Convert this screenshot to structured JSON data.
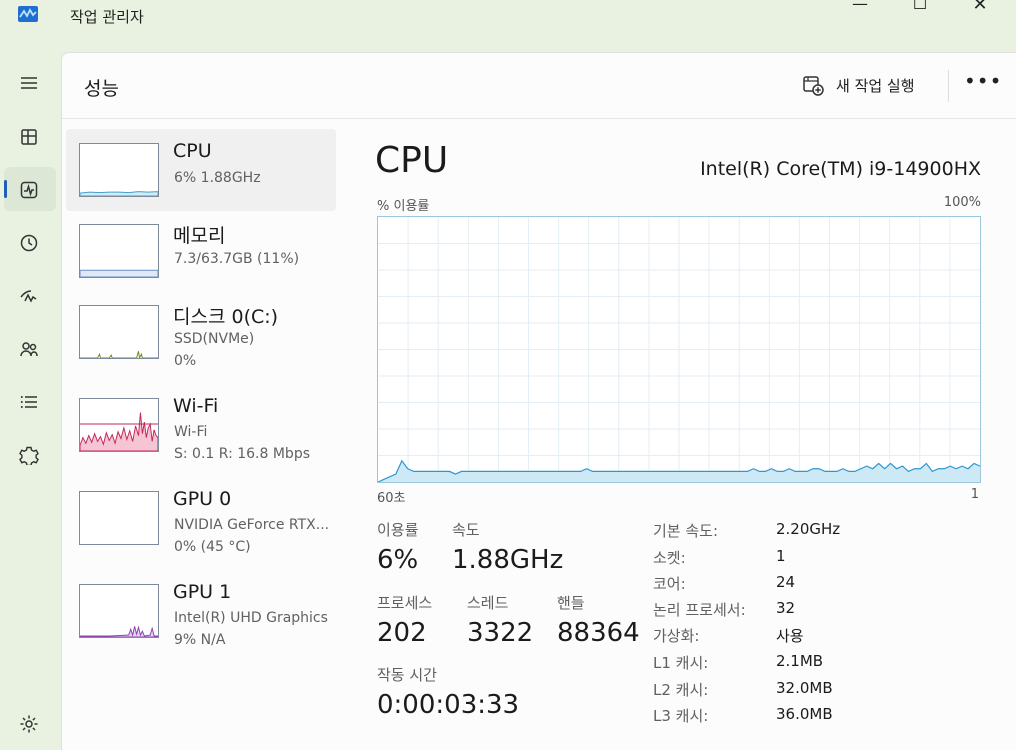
{
  "window": {
    "title": "작업 관리자",
    "minimize_glyph": "—",
    "maximize_glyph": "☐",
    "close_glyph": "✕"
  },
  "header": {
    "title": "성능",
    "new_task_label": "새 작업 실행",
    "more_glyph": "•••"
  },
  "nav": [
    "menu-icon",
    "processes-icon",
    "performance-icon",
    "app-history-icon",
    "startup-icon",
    "users-icon",
    "details-icon",
    "services-icon",
    "settings-icon"
  ],
  "devices": [
    {
      "name": "CPU",
      "lines": [
        "6% 1.88GHz"
      ],
      "color": "#117dbb"
    },
    {
      "name": "메모리",
      "lines": [
        "7.3/63.7GB (11%)"
      ],
      "color": "#8b6ec7"
    },
    {
      "name": "디스크 0(C:)",
      "lines": [
        "SSD(NVMe)",
        "0%"
      ],
      "color": "#4da60c"
    },
    {
      "name": "Wi-Fi",
      "lines": [
        "Wi-Fi",
        "S: 0.1  R: 16.8 Mbps"
      ],
      "color": "#a74f01"
    },
    {
      "name": "GPU 0",
      "lines": [
        "NVIDIA GeForce RTX...",
        "0% (45 °C)"
      ],
      "color": "#8e44ad"
    },
    {
      "name": "GPU 1",
      "lines": [
        "Intel(R) UHD Graphics",
        "9% N/A"
      ],
      "color": "#8e44ad"
    }
  ],
  "detail": {
    "title": "CPU",
    "model": "Intel(R) Core(TM) i9-14900HX",
    "graph_label": "% 이용률",
    "graph_max": "100%",
    "axis_left": "60초",
    "axis_right": "1",
    "utilization_series": [
      0,
      1,
      2,
      3,
      8,
      5,
      4,
      4,
      4,
      4,
      4,
      4,
      4,
      3,
      4,
      4,
      4,
      4,
      4,
      4,
      4,
      4,
      4,
      4,
      4,
      4,
      4,
      4,
      4,
      4,
      4,
      4,
      4,
      4,
      4,
      5,
      4,
      4,
      4,
      4,
      4,
      4,
      4,
      4,
      4,
      4,
      4,
      4,
      4,
      4,
      4,
      4,
      4,
      4,
      4,
      4,
      4,
      4,
      4,
      4,
      4,
      4,
      4,
      5,
      4,
      4,
      5,
      4,
      4,
      5,
      4,
      4,
      4,
      5,
      5,
      4,
      4,
      4,
      5,
      4,
      4,
      5,
      6,
      5,
      7,
      5,
      7,
      5,
      6,
      4,
      5,
      5,
      7,
      4,
      5,
      5,
      6,
      5,
      6,
      5,
      7,
      6
    ],
    "stats": {
      "util_label": "이용률",
      "util_value": "6%",
      "speed_label": "속도",
      "speed_value": "1.88GHz",
      "proc_label": "프로세스",
      "proc_value": "202",
      "thread_label": "스레드",
      "thread_value": "3322",
      "handle_label": "핸들",
      "handle_value": "88364",
      "uptime_label": "작동 시간",
      "uptime_value": "0:00:03:33"
    },
    "specs": [
      {
        "label": "기본 속도:",
        "value": "2.20GHz"
      },
      {
        "label": "소켓:",
        "value": "1"
      },
      {
        "label": "코어:",
        "value": "24"
      },
      {
        "label": "논리 프로세서:",
        "value": "32"
      },
      {
        "label": "가상화:",
        "value": "사용"
      },
      {
        "label": "L1 캐시:",
        "value": "2.1MB"
      },
      {
        "label": "L2 캐시:",
        "value": "32.0MB"
      },
      {
        "label": "L3 캐시:",
        "value": "36.0MB"
      }
    ]
  }
}
